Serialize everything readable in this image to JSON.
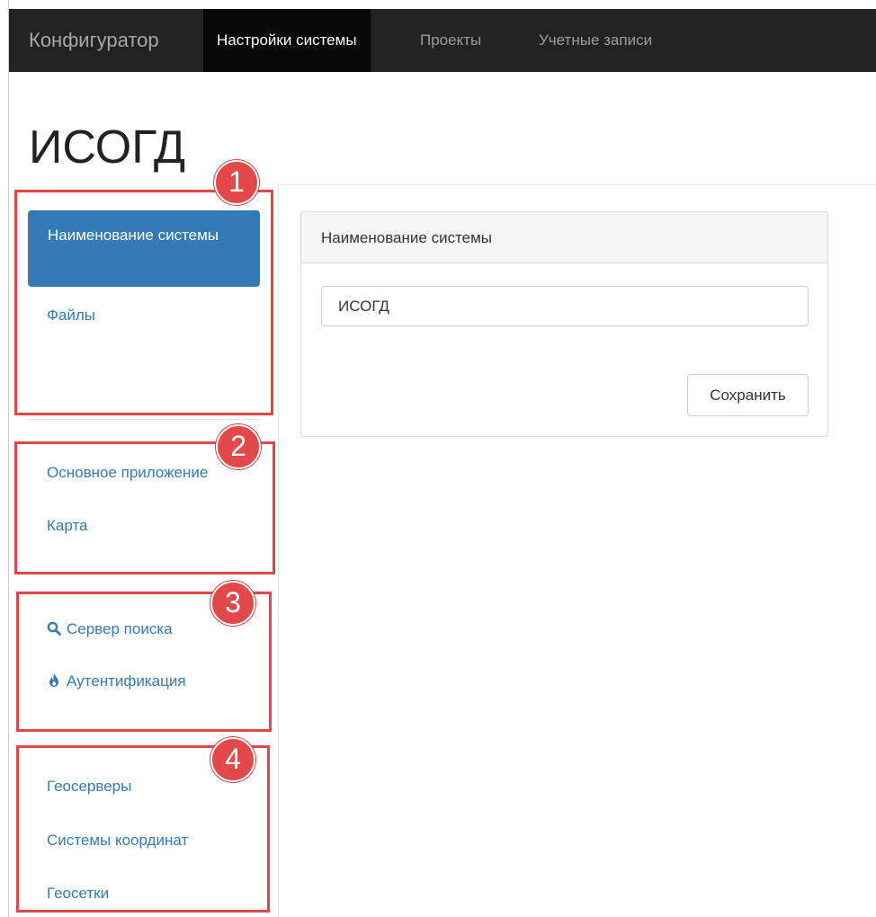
{
  "navbar": {
    "brand": "Конфигуратор",
    "items": [
      {
        "label": "Настройки системы",
        "active": true
      },
      {
        "label": "Проекты",
        "active": false
      },
      {
        "label": "Учетные записи",
        "active": false
      }
    ]
  },
  "page": {
    "title": "ИСОГД"
  },
  "sidebar": {
    "group1": [
      {
        "label": "Наименование системы",
        "active": true
      },
      {
        "label": "Файлы",
        "active": false
      }
    ],
    "group2": [
      {
        "label": "Основное приложение"
      },
      {
        "label": "Карта"
      }
    ],
    "group3": [
      {
        "label": "Сервер поиска",
        "icon": "search-icon"
      },
      {
        "label": "Аутентификация",
        "icon": "fire-icon"
      }
    ],
    "group4": [
      {
        "label": "Геосерверы"
      },
      {
        "label": "Системы координат"
      },
      {
        "label": "Геосетки"
      }
    ]
  },
  "callouts": [
    "1",
    "2",
    "3",
    "4"
  ],
  "panel": {
    "heading": "Наименование системы",
    "input_value": "ИСОГД",
    "save_label": "Сохранить"
  },
  "colors": {
    "navbar_bg": "#222222",
    "accent": "#337ab7",
    "callout": "#e0474c"
  }
}
